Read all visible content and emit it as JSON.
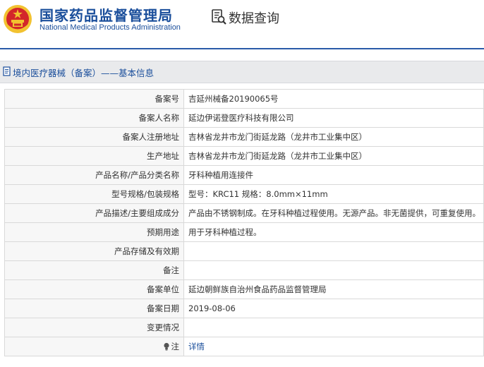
{
  "header": {
    "title_cn": "国家药品监督管理局",
    "title_en": "National Medical Products Administration",
    "query_label": "数据查询"
  },
  "breadcrumb": {
    "text": "境内医疗器械（备案）——基本信息"
  },
  "record": {
    "rows": [
      {
        "label": "备案号",
        "value": "吉延州械备20190065号"
      },
      {
        "label": "备案人名称",
        "value": "延边伊诺登医疗科技有限公司"
      },
      {
        "label": "备案人注册地址",
        "value": "吉林省龙井市龙门街延龙路（龙井市工业集中区）"
      },
      {
        "label": "生产地址",
        "value": "吉林省龙井市龙门街延龙路（龙井市工业集中区）"
      },
      {
        "label": "产品名称/产品分类名称",
        "value": "牙科种植用连接件"
      },
      {
        "label": "型号规格/包装规格",
        "value": "型号：KRC11 规格：8.0mm×11mm"
      },
      {
        "label": "产品描述/主要组成成分",
        "value": "产品由不锈钢制成。在牙科种植过程使用。无源产品。非无菌提供，可重复使用。"
      },
      {
        "label": "预期用途",
        "value": "用于牙科种植过程。"
      },
      {
        "label": "产品存储及有效期",
        "value": ""
      },
      {
        "label": "备注",
        "value": ""
      },
      {
        "label": "备案单位",
        "value": "延边朝鲜族自治州食品药品监督管理局"
      },
      {
        "label": "备案日期",
        "value": "2019-08-06"
      },
      {
        "label": "变更情况",
        "value": ""
      }
    ],
    "note": {
      "label": "注",
      "link_text": "详情"
    }
  },
  "colors": {
    "brand_blue": "#1a4e9b",
    "emblem_red": "#d3262a",
    "emblem_gold": "#f2c230",
    "crumb_bg": "#e9eaec"
  },
  "icons": [
    "national-emblem-icon",
    "data-query-icon",
    "document-icon",
    "lightbulb-icon"
  ]
}
